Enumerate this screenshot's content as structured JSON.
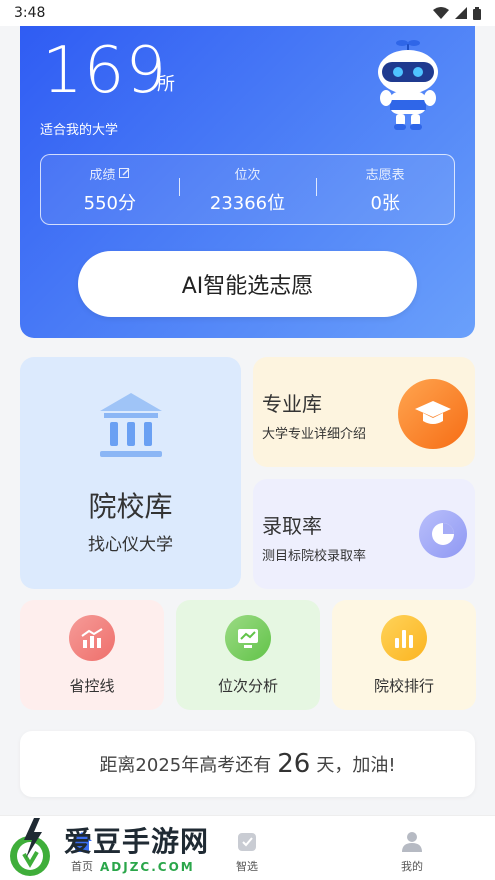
{
  "status_bar": {
    "time": "3:48"
  },
  "hero": {
    "count": "169",
    "count_unit": "所",
    "subtitle": "适合我的大学",
    "stats": [
      {
        "label": "成绩",
        "value": "550分"
      },
      {
        "label": "位次",
        "value": "23366位"
      },
      {
        "label": "志愿表",
        "value": "0张"
      }
    ],
    "ai_button": "AI智能选志愿",
    "gradient_colors": [
      "#2f5cf3",
      "#6aa0fb"
    ]
  },
  "cards": {
    "school": {
      "title": "院校库",
      "subtitle": "找心仪大学",
      "icon": "bank-icon"
    },
    "major": {
      "title": "专业库",
      "subtitle": "大学专业详细介绍",
      "icon": "graduation-cap-icon"
    },
    "rate": {
      "title": "录取率",
      "subtitle": "测目标院校录取率",
      "icon": "pie-chart-icon"
    }
  },
  "small_cards": [
    {
      "label": "省控线",
      "icon": "chart-up-icon"
    },
    {
      "label": "位次分析",
      "icon": "monitor-chart-icon"
    },
    {
      "label": "院校排行",
      "icon": "bar-chart-icon"
    }
  ],
  "countdown": {
    "prefix": "距离2025年高考还有",
    "days": "26",
    "suffix": "天，加油!"
  },
  "tabbar": [
    {
      "label": "首页",
      "icon": "home-icon"
    },
    {
      "label": "智选",
      "icon": "smart-select-icon"
    },
    {
      "label": "我的",
      "icon": "person-icon"
    }
  ],
  "watermark": {
    "title": "爱豆手游网",
    "url": "ADJZC.COM"
  }
}
